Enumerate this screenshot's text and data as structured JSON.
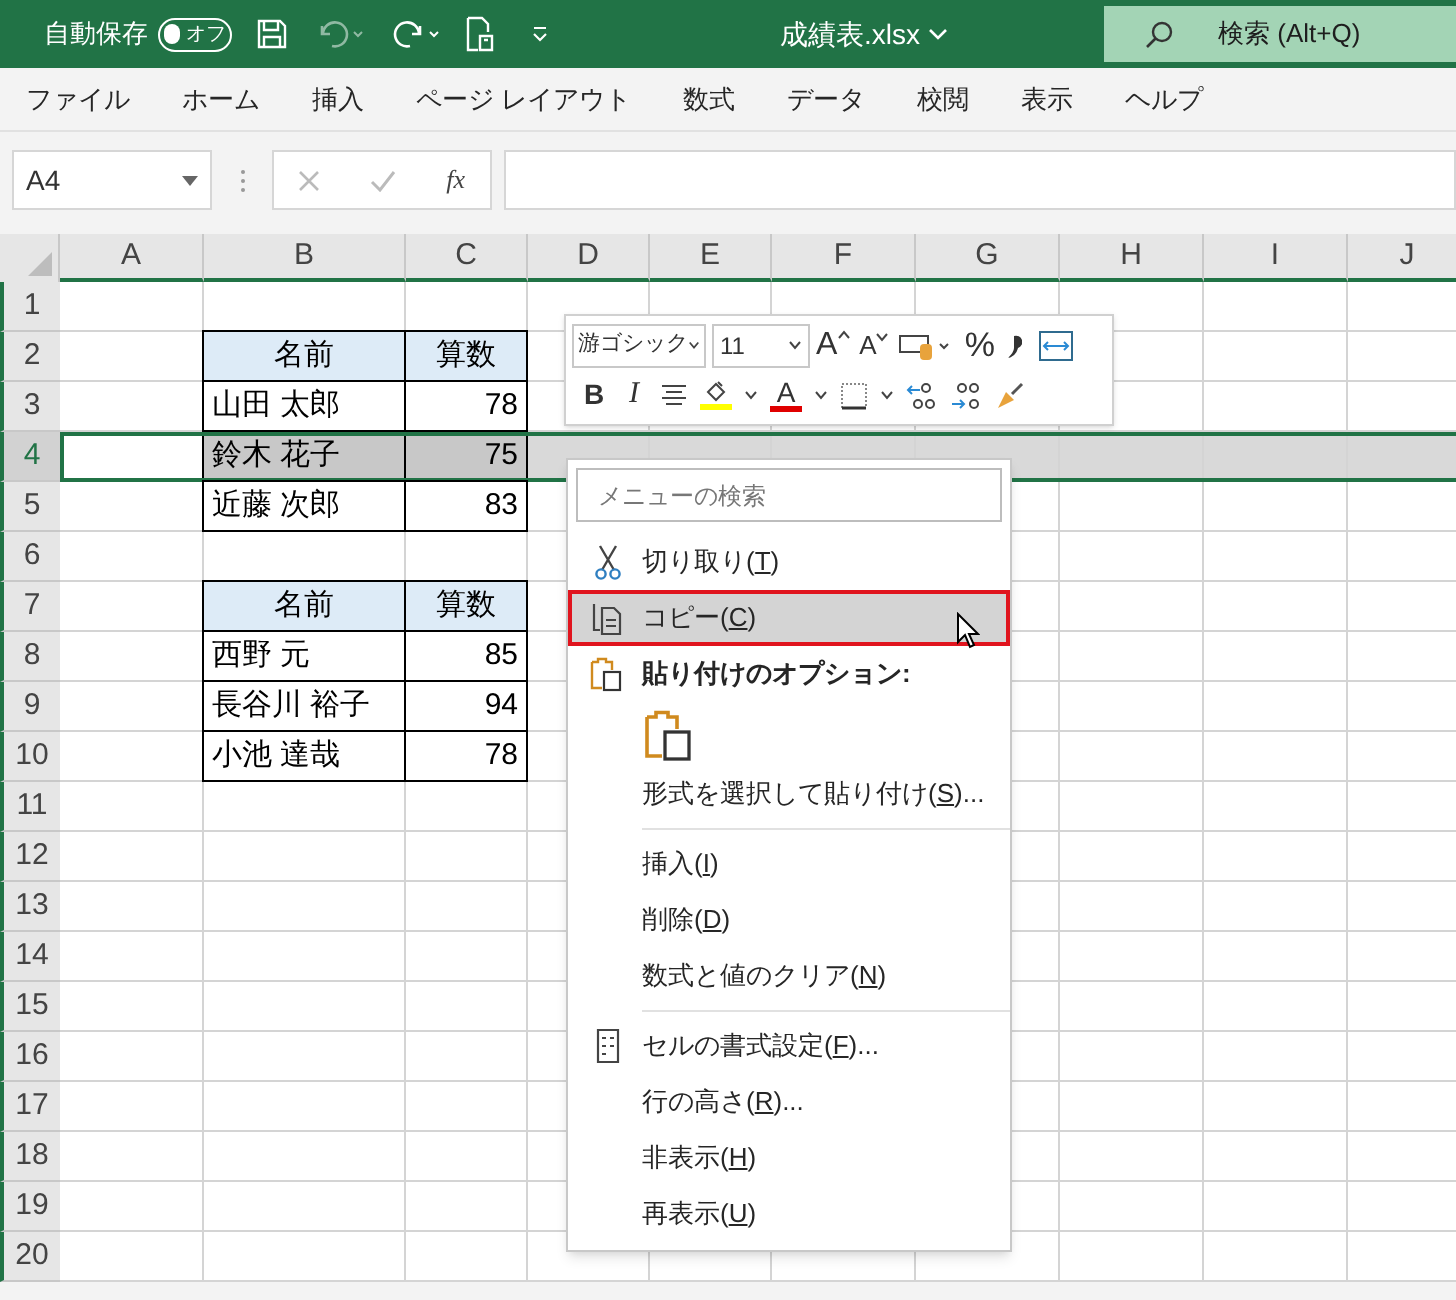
{
  "title_bar": {
    "autosave_label": "自動保存",
    "autosave_toggle": {
      "label": "オフ",
      "on": false
    },
    "file_title": "成績表.xlsx",
    "search_placeholder": "検索 (Alt+Q)"
  },
  "menu_tabs": [
    "ファイル",
    "ホーム",
    "挿入",
    "ページ レイアウト",
    "数式",
    "データ",
    "校閲",
    "表示",
    "ヘルプ"
  ],
  "formula_bar": {
    "name_box": "A4",
    "fx_label": "fx"
  },
  "sheet": {
    "columns": [
      "A",
      "B",
      "C",
      "D",
      "E",
      "F",
      "G",
      "H",
      "I",
      "J"
    ],
    "rows": [
      {
        "label": "1",
        "selected": false,
        "cells": []
      },
      {
        "label": "2",
        "selected": false,
        "cells": [
          {
            "kind": "blank"
          },
          {
            "kind": "header",
            "text": "名前"
          },
          {
            "kind": "header",
            "text": "算数"
          }
        ]
      },
      {
        "label": "3",
        "selected": false,
        "cells": [
          {
            "kind": "blank"
          },
          {
            "kind": "name",
            "text": "山田 太郎"
          },
          {
            "kind": "number",
            "text": "78"
          }
        ]
      },
      {
        "label": "4",
        "selected": true,
        "cells": [
          {
            "kind": "blank"
          },
          {
            "kind": "name",
            "text": "鈴木 花子"
          },
          {
            "kind": "number",
            "text": "75"
          }
        ]
      },
      {
        "label": "5",
        "selected": false,
        "cells": [
          {
            "kind": "blank"
          },
          {
            "kind": "name",
            "text": "近藤 次郎"
          },
          {
            "kind": "number",
            "text": "83"
          }
        ]
      },
      {
        "label": "6",
        "selected": false,
        "cells": []
      },
      {
        "label": "7",
        "selected": false,
        "cells": [
          {
            "kind": "blank"
          },
          {
            "kind": "header",
            "text": "名前"
          },
          {
            "kind": "header",
            "text": "算数"
          }
        ]
      },
      {
        "label": "8",
        "selected": false,
        "cells": [
          {
            "kind": "blank"
          },
          {
            "kind": "name",
            "text": "西野 元"
          },
          {
            "kind": "number",
            "text": "85"
          }
        ]
      },
      {
        "label": "9",
        "selected": false,
        "cells": [
          {
            "kind": "blank"
          },
          {
            "kind": "name",
            "text": "長谷川 裕子"
          },
          {
            "kind": "number",
            "text": "94"
          }
        ]
      },
      {
        "label": "10",
        "selected": false,
        "cells": [
          {
            "kind": "blank"
          },
          {
            "kind": "name",
            "text": "小池 達哉"
          },
          {
            "kind": "number",
            "text": "78"
          }
        ]
      },
      {
        "label": "11",
        "selected": false,
        "cells": []
      },
      {
        "label": "12",
        "selected": false,
        "cells": []
      },
      {
        "label": "13",
        "selected": false,
        "cells": []
      },
      {
        "label": "14",
        "selected": false,
        "cells": []
      },
      {
        "label": "15",
        "selected": false,
        "cells": []
      },
      {
        "label": "16",
        "selected": false,
        "cells": []
      },
      {
        "label": "17",
        "selected": false,
        "cells": []
      },
      {
        "label": "18",
        "selected": false,
        "cells": []
      },
      {
        "label": "19",
        "selected": false,
        "cells": []
      },
      {
        "label": "20",
        "selected": false,
        "cells": []
      }
    ]
  },
  "mini_toolbar": {
    "font_name": "游ゴシック",
    "font_size": "11",
    "grow_label": "A",
    "shrink_label": "A",
    "percent_label": "%",
    "bold_label": "B",
    "italic_label": "I",
    "font_color_label": "A"
  },
  "context_menu": {
    "search_placeholder": "メニューの検索",
    "items": [
      {
        "kind": "cut",
        "before": "切り取り(",
        "key": "T",
        "after": ")",
        "selected": false
      },
      {
        "kind": "copy",
        "before": "コピー(",
        "key": "C",
        "after": ")",
        "selected": true
      },
      {
        "kind": "heading",
        "text": "貼り付けのオプション:"
      },
      {
        "kind": "paste_option"
      },
      {
        "kind": "command",
        "before": "形式を選択して貼り付け(",
        "key": "S",
        "after": ")...",
        "selected": false
      },
      {
        "kind": "separator"
      },
      {
        "kind": "command",
        "before": "挿入(",
        "key": "I",
        "after": ")",
        "selected": false
      },
      {
        "kind": "command",
        "before": "削除(",
        "key": "D",
        "after": ")",
        "selected": false
      },
      {
        "kind": "command",
        "before": "数式と値のクリア(",
        "key": "N",
        "after": ")",
        "selected": false
      },
      {
        "kind": "separator"
      },
      {
        "kind": "format_cells",
        "before": "セルの書式設定(",
        "key": "F",
        "after": ")...",
        "selected": false
      },
      {
        "kind": "command",
        "before": "行の高さ(",
        "key": "R",
        "after": ")...",
        "selected": false
      },
      {
        "kind": "command",
        "before": "非表示(",
        "key": "H",
        "after": ")",
        "selected": false
      },
      {
        "kind": "command",
        "before": "再表示(",
        "key": "U",
        "after": ")",
        "selected": false
      }
    ]
  }
}
